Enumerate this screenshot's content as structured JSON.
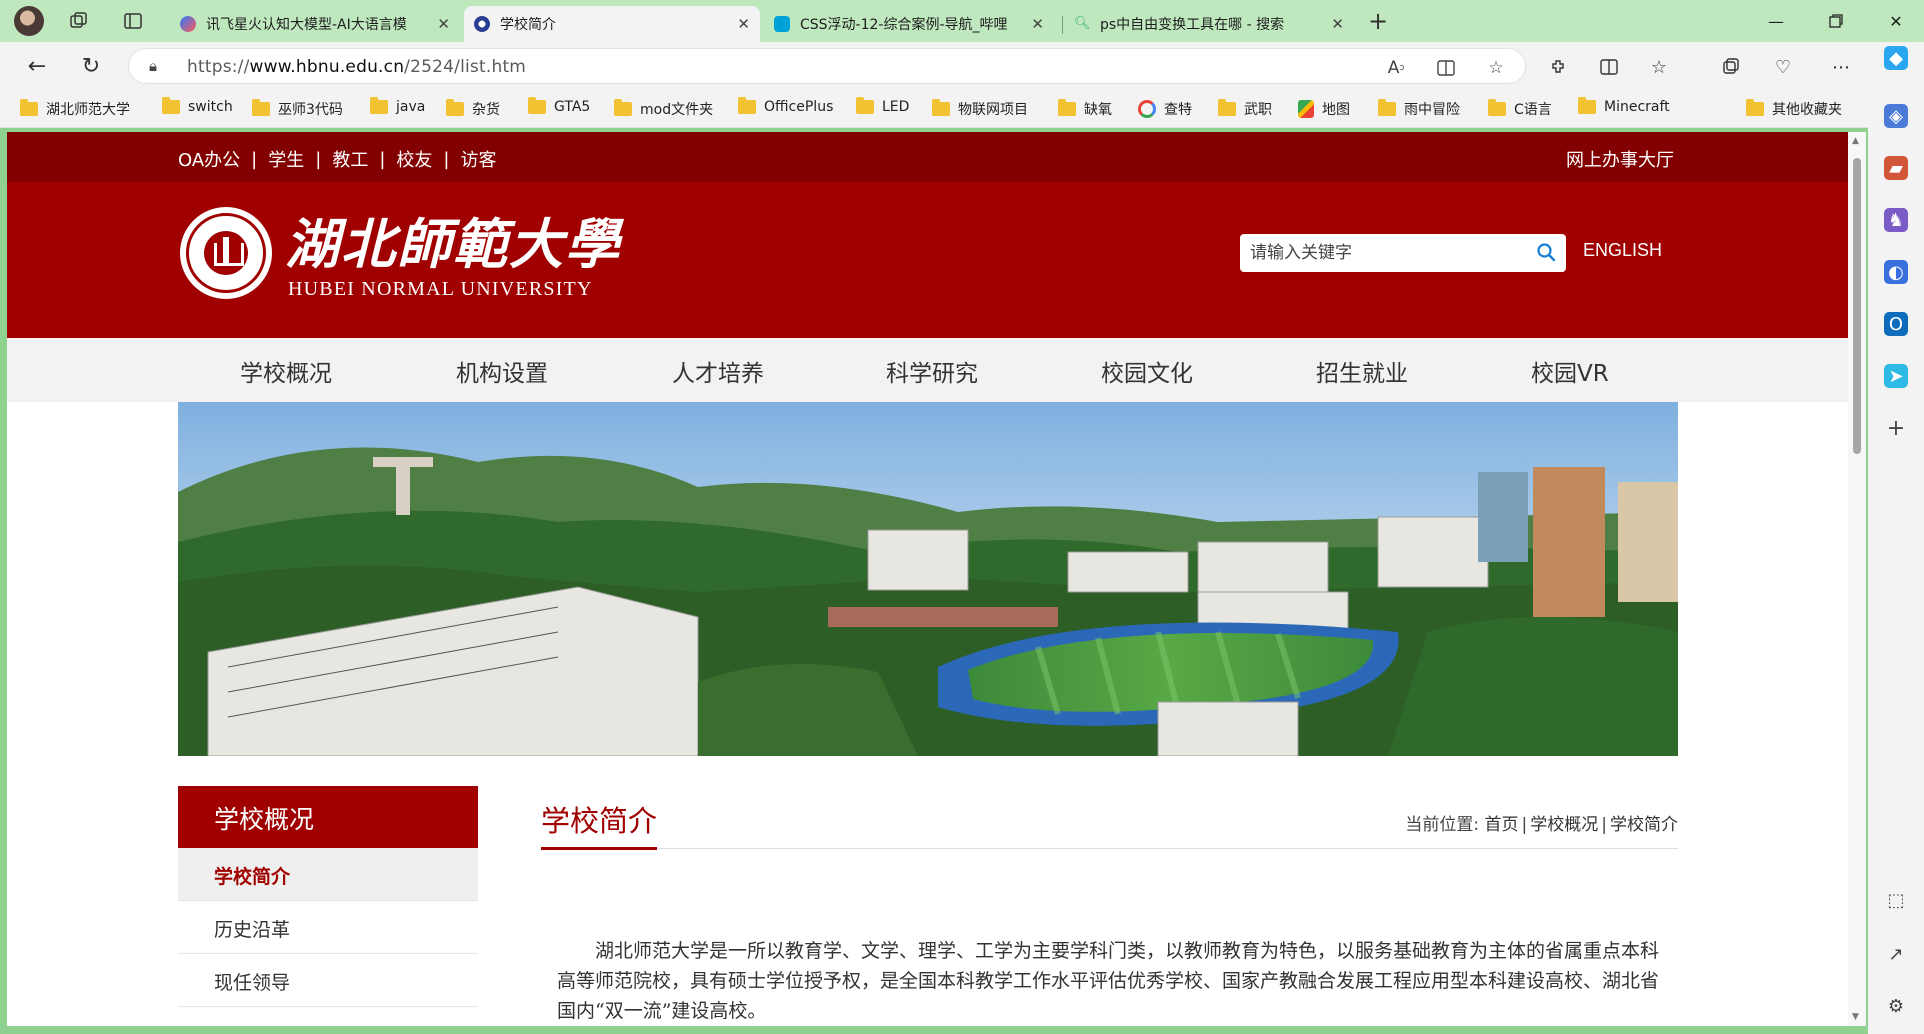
{
  "browser": {
    "tabs": [
      {
        "title": "讯飞星火认知大模型-AI大语言模",
        "active": false
      },
      {
        "title": "学校简介",
        "active": true
      },
      {
        "title": "CSS浮动-12-综合案例-导航_哔哩",
        "active": false
      },
      {
        "title": "ps中自由变换工具在哪 - 搜索",
        "active": false
      }
    ],
    "url_prefix": "https://",
    "url_host": "www.hbnu.edu.cn",
    "url_path": "/2524/list.htm",
    "bookmarks": [
      "湖北师范大学",
      "switch",
      "巫师3代码",
      "java",
      "杂货",
      "GTA5",
      "mod文件夹",
      "OfficePlus",
      "LED",
      "物联网项目",
      "缺氧",
      "查特",
      "武职",
      "地图",
      "雨中冒险",
      "C语言",
      "Minecraft"
    ],
    "other_bookmarks": "其他收藏夹"
  },
  "site": {
    "top_links": [
      "OA办公",
      "学生",
      "教工",
      "校友",
      "访客"
    ],
    "top_right": "网上办事大厅",
    "logo_cn": "湖北師範大學",
    "logo_en": "HUBEI NORMAL UNIVERSITY",
    "search_placeholder": "请输入关键字",
    "english": "ENGLISH",
    "nav": [
      "学校概况",
      "机构设置",
      "人才培养",
      "科学研究",
      "校园文化",
      "招生就业",
      "校园VR"
    ],
    "side_title": "学校概况",
    "side_items": [
      "学校简介",
      "历史沿革",
      "现任领导"
    ],
    "content_title": "学校简介",
    "crumb_label": "当前位置:",
    "crumbs": [
      "首页",
      "学校概况",
      "学校简介"
    ],
    "intro": "湖北师范大学是一所以教育学、文学、理学、工学为主要学科门类，以教师教育为特色，以服务基础教育为主体的省属重点本科高等师范院校，具有硕士学位授予权，是全国本科教学工作水平评估优秀学校、国家产教融合发展工程应用型本科建设高校、湖北省国内“双一流”建设高校。"
  },
  "colors": {
    "brand_red": "#a00000",
    "topbar_red": "#820000",
    "window_frame": "#8fd28f"
  }
}
